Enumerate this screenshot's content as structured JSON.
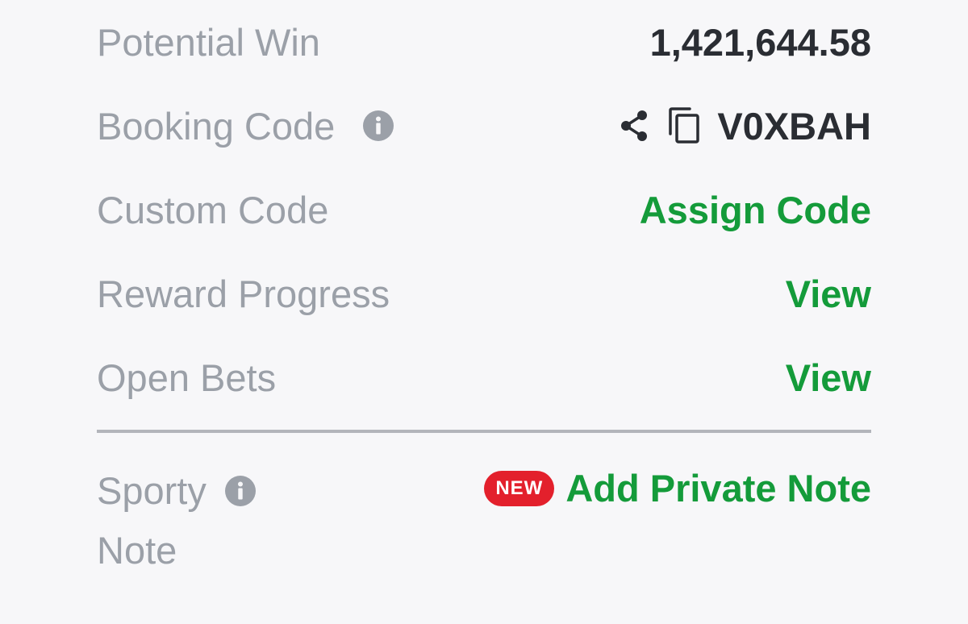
{
  "rows": {
    "potential_win": {
      "label": "Potential Win",
      "value": "1,421,644.58"
    },
    "booking_code": {
      "label": "Booking Code",
      "value": "V0XBAH",
      "icons": [
        "info-icon",
        "share-icon",
        "copy-icon"
      ]
    },
    "custom_code": {
      "label": "Custom Code",
      "action": "Assign Code"
    },
    "reward_progress": {
      "label": "Reward Progress",
      "action": "View"
    },
    "open_bets": {
      "label": "Open Bets",
      "action": "View"
    }
  },
  "note": {
    "label_line1": "Sporty",
    "label_line2": "Note",
    "badge": "NEW",
    "action": "Add Private Note"
  },
  "colors": {
    "label": "#9ba0a8",
    "value": "#2a2d33",
    "action_green": "#149b3a",
    "badge_red": "#e3202c",
    "background": "#f7f7f9"
  }
}
